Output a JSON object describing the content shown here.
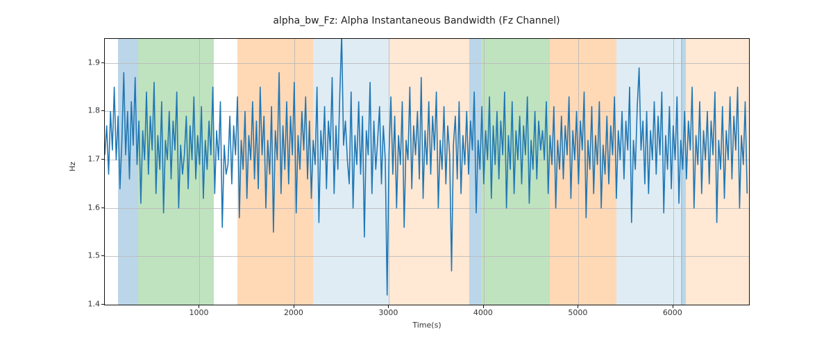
{
  "chart_data": {
    "type": "line",
    "title": "alpha_bw_Fz: Alpha Instantaneous Bandwidth (Fz Channel)",
    "xlabel": "Time(s)",
    "ylabel": "Hz",
    "xlim": [
      0,
      6800
    ],
    "ylim": [
      1.4,
      1.95
    ],
    "xticks": [
      1000,
      2000,
      3000,
      4000,
      5000,
      6000
    ],
    "yticks": [
      1.4,
      1.5,
      1.6,
      1.7,
      1.8,
      1.9
    ],
    "background_spans": [
      {
        "x0": 140,
        "x1": 350,
        "color": "blue"
      },
      {
        "x0": 350,
        "x1": 1150,
        "color": "green"
      },
      {
        "x0": 1400,
        "x1": 2200,
        "color": "orange"
      },
      {
        "x0": 2200,
        "x1": 3000,
        "color": "lblue"
      },
      {
        "x0": 3000,
        "x1": 3850,
        "color": "lorange"
      },
      {
        "x0": 3850,
        "x1": 3970,
        "color": "blue"
      },
      {
        "x0": 3970,
        "x1": 4700,
        "color": "green"
      },
      {
        "x0": 4700,
        "x1": 5400,
        "color": "orange"
      },
      {
        "x0": 5400,
        "x1": 6100,
        "color": "lblue"
      },
      {
        "x0": 6080,
        "x1": 6130,
        "color": "blue"
      },
      {
        "x0": 6130,
        "x1": 6800,
        "color": "lorange"
      }
    ],
    "series": [
      {
        "name": "alpha_bw_Fz",
        "color": "#1f77b4",
        "x_step": 20,
        "x_start": 0,
        "values": [
          1.71,
          1.77,
          1.67,
          1.8,
          1.72,
          1.85,
          1.7,
          1.79,
          1.64,
          1.74,
          1.88,
          1.71,
          1.8,
          1.66,
          1.82,
          1.73,
          1.87,
          1.69,
          1.78,
          1.61,
          1.76,
          1.7,
          1.84,
          1.67,
          1.79,
          1.72,
          1.86,
          1.63,
          1.75,
          1.68,
          1.82,
          1.59,
          1.74,
          1.7,
          1.8,
          1.66,
          1.78,
          1.72,
          1.84,
          1.6,
          1.73,
          1.67,
          1.71,
          1.79,
          1.64,
          1.77,
          1.7,
          1.83,
          1.66,
          1.75,
          1.69,
          1.81,
          1.62,
          1.74,
          1.68,
          1.78,
          1.71,
          1.85,
          1.63,
          1.76,
          1.7,
          1.82,
          1.56,
          1.73,
          1.67,
          1.69,
          1.79,
          1.65,
          1.77,
          1.71,
          1.83,
          1.58,
          1.74,
          1.68,
          1.8,
          1.62,
          1.75,
          1.7,
          1.82,
          1.66,
          1.78,
          1.64,
          1.85,
          1.71,
          1.79,
          1.6,
          1.74,
          1.67,
          1.81,
          1.55,
          1.76,
          1.7,
          1.88,
          1.63,
          1.77,
          1.68,
          1.82,
          1.65,
          1.79,
          1.71,
          1.86,
          1.59,
          1.75,
          1.68,
          1.8,
          1.72,
          1.83,
          1.66,
          1.78,
          1.62,
          1.74,
          1.69,
          1.85,
          1.57,
          1.76,
          1.7,
          1.81,
          1.64,
          1.78,
          1.72,
          1.87,
          1.63,
          1.77,
          1.68,
          1.83,
          1.96,
          1.73,
          1.78,
          1.7,
          1.65,
          1.84,
          1.6,
          1.75,
          1.69,
          1.82,
          1.67,
          1.79,
          1.54,
          1.76,
          1.71,
          1.86,
          1.63,
          1.78,
          1.68,
          1.74,
          1.81,
          1.65,
          1.77,
          1.7,
          1.42,
          1.71,
          1.83,
          1.67,
          1.79,
          1.6,
          1.75,
          1.69,
          1.82,
          1.56,
          1.74,
          1.7,
          1.85,
          1.64,
          1.77,
          1.71,
          1.8,
          1.66,
          1.87,
          1.62,
          1.76,
          1.69,
          1.82,
          1.67,
          1.79,
          1.72,
          1.84,
          1.6,
          1.74,
          1.68,
          1.81,
          1.65,
          1.77,
          1.71,
          1.47,
          1.73,
          1.79,
          1.66,
          1.82,
          1.63,
          1.75,
          1.69,
          1.8,
          1.67,
          1.78,
          1.72,
          1.84,
          1.59,
          1.74,
          1.68,
          1.81,
          1.65,
          1.76,
          1.7,
          1.83,
          1.62,
          1.77,
          1.69,
          1.8,
          1.66,
          1.78,
          1.71,
          1.84,
          1.6,
          1.75,
          1.68,
          1.82,
          1.63,
          1.76,
          1.7,
          1.79,
          1.65,
          1.77,
          1.71,
          1.83,
          1.61,
          1.74,
          1.68,
          1.8,
          1.66,
          1.78,
          1.72,
          1.76,
          1.7,
          1.82,
          1.63,
          1.75,
          1.69,
          1.81,
          1.6,
          1.74,
          1.68,
          1.79,
          1.66,
          1.77,
          1.71,
          1.83,
          1.62,
          1.76,
          1.7,
          1.8,
          1.65,
          1.78,
          1.72,
          1.84,
          1.58,
          1.74,
          1.68,
          1.81,
          1.63,
          1.75,
          1.69,
          1.82,
          1.6,
          1.73,
          1.67,
          1.79,
          1.65,
          1.77,
          1.71,
          1.83,
          1.62,
          1.76,
          1.7,
          1.8,
          1.66,
          1.78,
          1.72,
          1.85,
          1.57,
          1.74,
          1.68,
          1.81,
          1.89,
          1.72,
          1.78,
          1.65,
          1.8,
          1.63,
          1.76,
          1.7,
          1.82,
          1.67,
          1.79,
          1.71,
          1.84,
          1.59,
          1.75,
          1.68,
          1.81,
          1.64,
          1.77,
          1.7,
          1.83,
          1.61,
          1.74,
          1.68,
          1.8,
          1.66,
          1.78,
          1.72,
          1.85,
          1.6,
          1.75,
          1.69,
          1.82,
          1.63,
          1.76,
          1.7,
          1.8,
          1.65,
          1.78,
          1.71,
          1.84,
          1.57,
          1.74,
          1.68,
          1.81,
          1.62,
          1.76,
          1.7,
          1.83,
          1.66,
          1.79,
          1.72,
          1.85,
          1.6,
          1.75,
          1.69,
          1.82,
          1.63
        ]
      }
    ]
  }
}
